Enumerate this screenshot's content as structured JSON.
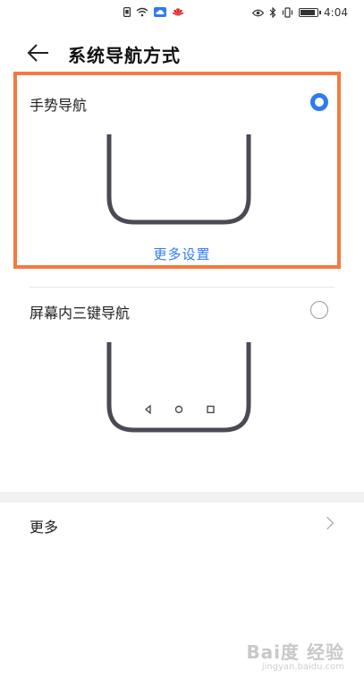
{
  "status_bar": {
    "time": "4:04",
    "left_icons": [
      "sim-icon",
      "wifi-icon",
      "cloud-icon",
      "huawei-logo-icon"
    ],
    "right_icons": [
      "eye-icon",
      "bluetooth-icon",
      "vibrate-icon",
      "battery-icon"
    ],
    "battery_level": 0.8
  },
  "header": {
    "back_icon": "arrow-left-icon",
    "title": "系统导航方式"
  },
  "options": [
    {
      "label": "手势导航",
      "selected": true,
      "link": "更多设置"
    },
    {
      "label": "屏幕内三键导航",
      "selected": false,
      "nav_icons": [
        "back-triangle-icon",
        "home-circle-icon",
        "recents-square-icon"
      ]
    }
  ],
  "more": {
    "label": "更多",
    "chevron": "chevron-right-icon"
  },
  "watermark": {
    "brand": "Bai度 经验",
    "url": "jingyan.baidu.com"
  },
  "colors": {
    "accent": "#2f7bf0",
    "highlight_border": "#f47a3f",
    "phone_outline": "#4a4a54"
  }
}
